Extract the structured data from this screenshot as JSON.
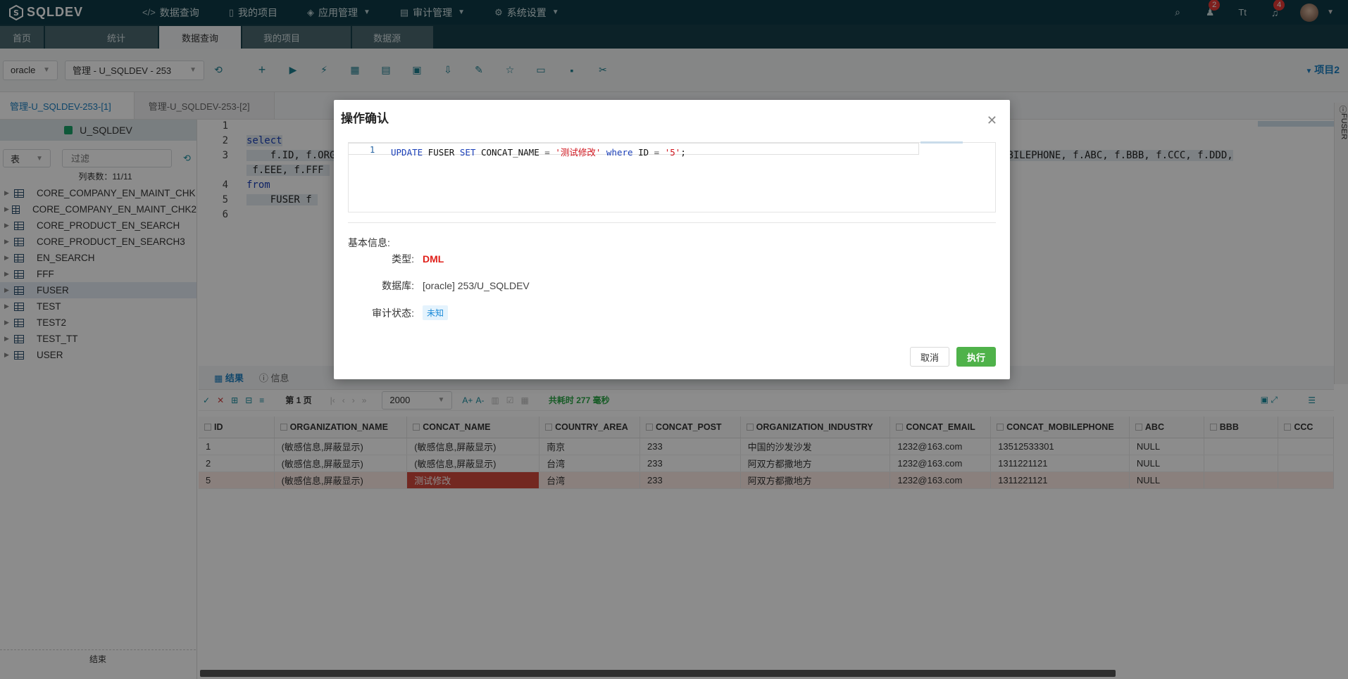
{
  "app": {
    "logo_text": "SQLDEV"
  },
  "topnav": {
    "items": [
      {
        "label": "数据查询",
        "icon": "code-icon",
        "has_dropdown": false
      },
      {
        "label": "我的项目",
        "icon": "bookmark-icon",
        "has_dropdown": false
      },
      {
        "label": "应用管理",
        "icon": "cube-icon",
        "has_dropdown": true
      },
      {
        "label": "审计管理",
        "icon": "audit-icon",
        "has_dropdown": true
      },
      {
        "label": "系统设置",
        "icon": "gear-icon",
        "has_dropdown": true
      }
    ],
    "notifications_badge": "2",
    "messages_badge": "4"
  },
  "main_tabs": [
    "首页",
    "统计",
    "数据查询",
    "我的项目",
    "数据源"
  ],
  "main_tab_active": "数据查询",
  "toolbar": {
    "db_type": "oracle",
    "connection": "管理 - U_SQLDEV - 253",
    "project": "项目2"
  },
  "editor_tabs": [
    "管理-U_SQLDEV-253-[1]",
    "管理-U_SQLDEV-253-[2]"
  ],
  "sidebar": {
    "schema": "U_SQLDEV",
    "filter_type": "表",
    "filter_placeholder": "过滤",
    "count_label": "列表数：11/11",
    "tables": [
      "CORE_COMPANY_EN_MAINT_CHK",
      "CORE_COMPANY_EN_MAINT_CHK2",
      "CORE_PRODUCT_EN_SEARCH",
      "CORE_PRODUCT_EN_SEARCH3",
      "EN_SEARCH",
      "FFF",
      "FUSER",
      "TEST",
      "TEST2",
      "TEST_TT",
      "USER"
    ],
    "selected": "FUSER",
    "footer": "结束"
  },
  "editor": {
    "line_numbers": [
      "1",
      "2",
      "3",
      "4",
      "5",
      "6"
    ],
    "line2": "select",
    "line3a": "    f.ID, f.ORG",
    "line3b": "OBILEPHONE, f.ABC, f.BBB, f.CCC, f.DDD,",
    "line3c": " f.EEE, f.FFF ",
    "line4": "from",
    "line5": "    FUSER f ",
    "side_rail_label": "FUSER"
  },
  "results": {
    "tabs": [
      "结果",
      "信息"
    ],
    "page_label": "第 1 页",
    "page_size": "2000",
    "elapsed": "共耗时 277 毫秒",
    "columns": [
      "ID",
      "ORGANIZATION_NAME",
      "CONCAT_NAME",
      "COUNTRY_AREA",
      "CONCAT_POST",
      "ORGANIZATION_INDUSTRY",
      "CONCAT_EMAIL",
      "CONCAT_MOBILEPHONE",
      "ABC",
      "BBB",
      "CCC"
    ],
    "rows": [
      [
        "1",
        "(敏感信息,屏蔽显示)",
        "(敏感信息,屏蔽显示)",
        "南京",
        "233",
        "中国的沙发沙发",
        "1232@163.com",
        "13512533301",
        "NULL",
        "",
        ""
      ],
      [
        "2",
        "(敏感信息,屏蔽显示)",
        "(敏感信息,屏蔽显示)",
        "台湾",
        "233",
        "阿双方都撒地方",
        "1232@163.com",
        "1311221121",
        "NULL",
        "",
        ""
      ],
      [
        "5",
        "(敏感信息,屏蔽显示)",
        "测试修改",
        "台湾",
        "233",
        "阿双方都撒地方",
        "1232@163.com",
        "1311221121",
        "NULL",
        "",
        ""
      ]
    ],
    "modified_row_index": 2,
    "modified_col_index": 2
  },
  "modal": {
    "title": "操作确认",
    "sql_line_number": "1",
    "basic_info_label": "基本信息:",
    "type_label": "类型:",
    "type_value": "DML",
    "db_label": "数据库:",
    "db_value": "[oracle] 253/U_SQLDEV",
    "audit_label": "审计状态:",
    "audit_value": "未知",
    "cancel_label": "取消",
    "execute_label": "执行"
  },
  "colors": {
    "nav_bg": "#0e3a46",
    "accent": "#1a7fc1",
    "execute_green": "#4fb24a",
    "dml_red": "#e0201b",
    "modified_cell": "#d24a3d"
  }
}
